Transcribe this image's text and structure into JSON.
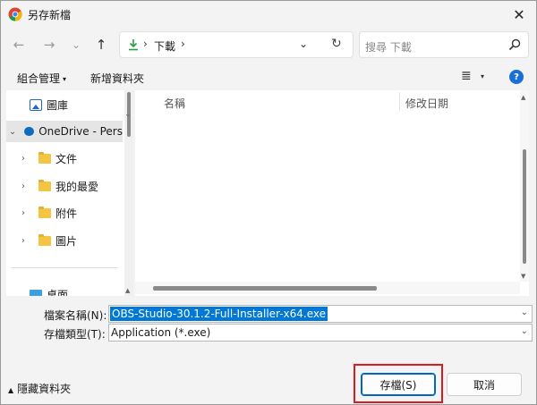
{
  "window": {
    "title": "另存新檔",
    "close_glyph": "✕"
  },
  "nav": {
    "back_glyph": "←",
    "forward_glyph": "→",
    "history_glyph": "⌄",
    "up_glyph": "↑",
    "breadcrumb_sep": "›",
    "breadcrumb": "下載",
    "breadcrumb_trailing_sep": "›",
    "dropdown_glyph": "⌄",
    "refresh_glyph": "↻",
    "search_placeholder": "搜尋 下載"
  },
  "commands": {
    "organize": "組合管理",
    "organize_caret": "▾",
    "new_folder": "新增資料夾",
    "view_glyph": "≣",
    "view_caret": "▾",
    "help_glyph": "?"
  },
  "sidebar": {
    "items": [
      {
        "label": "圖庫",
        "icon": "pictures-icon",
        "arrow": ""
      },
      {
        "label": "OneDrive - Pers",
        "icon": "onedrive-icon",
        "arrow": "⌄"
      },
      {
        "label": "文件",
        "icon": "folder-icon",
        "arrow": "›"
      },
      {
        "label": "我的最愛",
        "icon": "folder-icon",
        "arrow": "›"
      },
      {
        "label": "附件",
        "icon": "folder-icon",
        "arrow": "›"
      },
      {
        "label": "圖片",
        "icon": "folder-icon",
        "arrow": "›"
      },
      {
        "label": "桌面",
        "icon": "desktop-icon",
        "arrow": ""
      }
    ]
  },
  "file_list": {
    "columns": [
      "名稱",
      "修改日期"
    ]
  },
  "form": {
    "filename_label": "檔案名稱(N):",
    "filename_value": "OBS-Studio-30.1.2-Full-Installer-x64.exe",
    "filetype_label": "存檔類型(T):",
    "filetype_value": "Application (*.exe)",
    "chevron": "⌄"
  },
  "footer": {
    "hide_folders_caret": "▲",
    "hide_folders": "隱藏資料夾",
    "save_label": "存檔(S)",
    "cancel_label": "取消"
  },
  "colors": {
    "accent": "#0067c0",
    "selection": "#0078d7",
    "highlight_box": "#e0191e"
  }
}
